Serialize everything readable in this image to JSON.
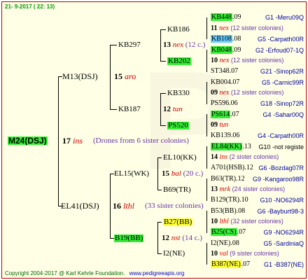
{
  "header": {
    "date": "21- 9-2017 ( 22: 13)"
  },
  "root": {
    "id": "M24(DSJ)",
    "gen": "17",
    "breeder": "ins",
    "note": "(Drones from 6 sister colonies)"
  },
  "gen1": [
    {
      "id": "M13(DSJ)",
      "gen": "15",
      "breeder": "aro"
    },
    {
      "id": "EL41(DSJ)",
      "gen": "16",
      "breeder": "lthl",
      "note": "(33 sister colonies)"
    }
  ],
  "gen2": [
    {
      "id": "KB297",
      "gen": "13",
      "breeder": "nex",
      "note": "(12 c.)"
    },
    {
      "id": "KB187",
      "gen": "12",
      "breeder": "tun"
    },
    {
      "id": "EL15(WK)",
      "gen": "15",
      "breeder": "bal",
      "note": "(20 c.)"
    },
    {
      "id": "B19(BB)",
      "gen": "12",
      "breeder": "nst",
      "note": "(14 c.)"
    }
  ],
  "gen3": [
    {
      "id": "KB186"
    },
    {
      "id": "KB202"
    },
    {
      "id": "KB330"
    },
    {
      "id": "PS520"
    },
    {
      "id": "EL10(KK)"
    },
    {
      "id": "B69(TR)"
    },
    {
      "id": "B27(BB)"
    },
    {
      "id": "I2(NE)"
    }
  ],
  "gen4": [
    {
      "id": "KB448",
      "yr": ".09",
      "loc": "G1 -Meru09Q"
    },
    {
      "gen": "11",
      "breeder": "nex",
      "note": "(12 sister colonies)"
    },
    {
      "id": "KB108",
      "yr": ".08",
      "loc": "G5 -Carpath00R"
    },
    {
      "id": "KB048",
      "yr": ".09",
      "loc": "G2 -Erfoud07-1Q"
    },
    {
      "gen": "10",
      "breeder": "nex",
      "note": "(12 sister colonies)"
    },
    {
      "id": "ST348",
      "yr": ".07",
      "loc": "G21 -Sinop62R"
    },
    {
      "id": "KB004",
      "yr": ".07",
      "loc": "G5 -Carnic99R"
    },
    {
      "gen": "09",
      "breeder": "nex",
      "note": "(12 sister colonies)"
    },
    {
      "id": "PS596",
      "yr": ".06",
      "loc": "G18 -Sinop72R"
    },
    {
      "id": "PS614",
      "yr": ".07",
      "loc": "G4 -Sahar00Q"
    },
    {
      "gen": "09",
      "breeder": "tun"
    },
    {
      "id": "KB139",
      "yr": ".06",
      "loc": "G4 -Carpath00R"
    },
    {
      "id": "EL84(KK)",
      "yr": ".13",
      "loc": "G10 -not registe"
    },
    {
      "gen": "14",
      "breeder": "ins",
      "note": "(2 sister colonies)"
    },
    {
      "id": "A701(HSB)",
      "yr": ".12",
      "loc": "G6 -Bozdag07R"
    },
    {
      "id": "B63(TR)",
      "yr": ".12",
      "loc": "G9 -Kangaroo98R"
    },
    {
      "gen": "13",
      "breeder": "mrk",
      "note": "(24 sister colonies)"
    },
    {
      "id": "B129(TR)",
      "yr": ".10",
      "loc": "G10 -NO6294R"
    },
    {
      "id": "B53(BB)",
      "yr": ".08",
      "loc": "G6 -Bayburt98-3"
    },
    {
      "gen": "10",
      "breeder": "lthl",
      "note": "(32 sister colonies)"
    },
    {
      "id": "B25(CS)",
      "yr": ".07",
      "loc": "G9 -NO6294R"
    },
    {
      "id": "I2(NE)",
      "yr": ".08",
      "loc": "G5 -SardiniaQ"
    },
    {
      "gen": "10",
      "breeder": "val",
      "note": "(9 sister colonies)"
    },
    {
      "id": "B387(NE)",
      "yr": ".07",
      "loc": "G1 -B387(NE)"
    }
  ],
  "footer": {
    "copyright": "Copyright 2004-2017 @ Karl Kehrle Foundation.",
    "url": "www.pedigreeapis.org"
  }
}
